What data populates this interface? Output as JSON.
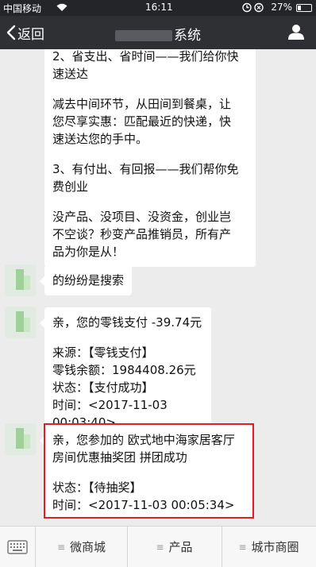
{
  "status_bar": {
    "carrier": "中国移动",
    "time": "16:11",
    "battery": "27%",
    "battery_level": 0.27
  },
  "header": {
    "back_label": "返回",
    "title_suffix": "系统"
  },
  "messages": {
    "m1": {
      "lines_a": "2、省支出、省时间——我们给你快\n速送达",
      "lines_b": "减去中间环节，从田间到餐桌，让\n您尽享实惠：匹配最近的快递，快\n速送达您的手中。",
      "lines_c": "3、有付出、有回报——我们帮你免\n费创业",
      "lines_d": "没产品、没项目、没资金，创业岂\n不空谈？秒变产品推销员，所有产\n品为你是从！"
    },
    "m2": {
      "text": "的纷纷是搜索"
    },
    "m3": {
      "line1": "亲，您的零钱支付 -39.74元",
      "line2": "来源：【零钱支付】",
      "line3": "零钱余额：1984408.26元",
      "line4": "状态：【支付成功】",
      "line5": "时间：<2017-11-03 00:03:40>"
    },
    "m4": {
      "line1": "亲，您参加的 欧式地中海家居客厅\n房间优惠抽奖团 拼团成功",
      "line2": "状态：【待抽奖】",
      "line3": "时间：<2017-11-03 00:05:34>"
    }
  },
  "bottom_menu": {
    "item1": "微商城",
    "item2": "产品",
    "item3": "城市商圈"
  },
  "colors": {
    "highlight_border": "#e3201f",
    "header_bg": "#2f3034",
    "chat_bg": "#ececec"
  }
}
